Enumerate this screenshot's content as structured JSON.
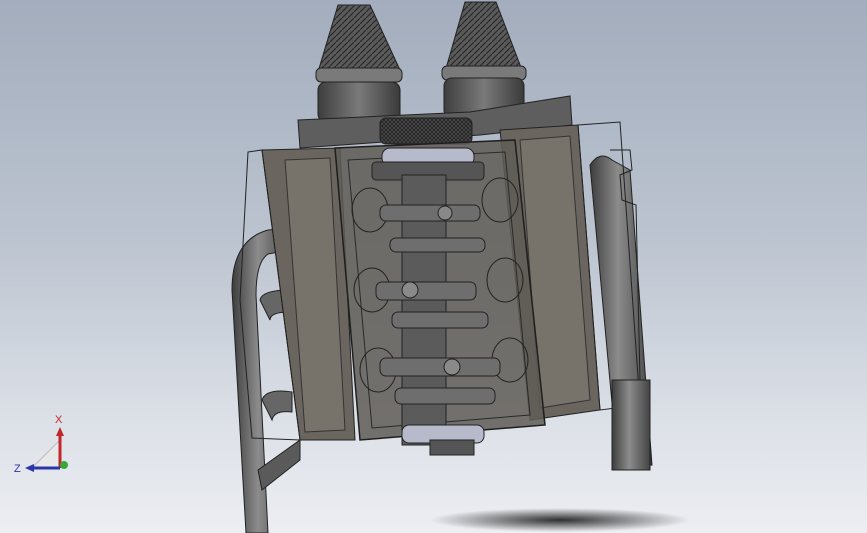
{
  "view": {
    "background_top": "#a3adbd",
    "background_bottom": "#eceef2",
    "model_colors": {
      "metal_dark": "#4a4a4a",
      "metal_mid": "#6b6b6b",
      "metal_light": "#8a8a8a",
      "edge": "#222222",
      "bearing_blue": "#7b86c8"
    }
  },
  "triad": {
    "x_label": "X",
    "z_label": "Z",
    "x_color": "#c0262b",
    "z_color": "#2a36a8",
    "y_color": "#3aa63a"
  }
}
